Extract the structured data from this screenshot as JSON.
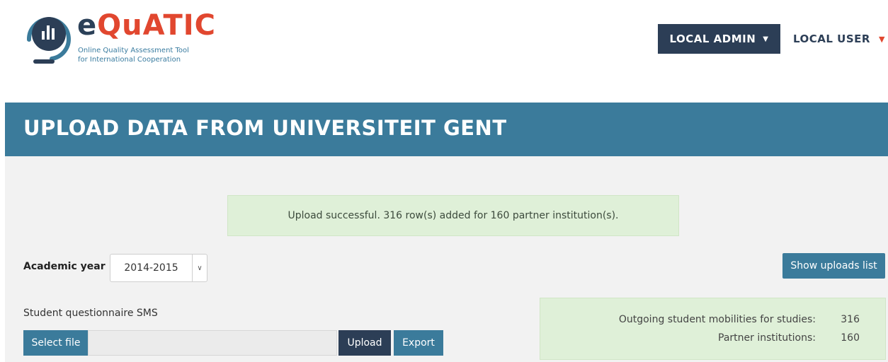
{
  "header": {
    "logo_title": "eQuATIC",
    "logo_sub_line1": "Online Quality Assessment Tool",
    "logo_sub_line2": "for International Cooperation",
    "nav_admin_label": "LOCAL ADMIN",
    "nav_user_label": "LOCAL USER"
  },
  "banner": {
    "title": "UPLOAD DATA FROM UNIVERSITEIT GENT"
  },
  "alert": {
    "message": "Upload successful. 316 row(s) added for 160 partner institution(s)."
  },
  "filters": {
    "academic_year_label": "Academic year",
    "academic_year_value": "2014-2015"
  },
  "toolbar": {
    "show_uploads_label": "Show uploads list"
  },
  "questionnaire": {
    "label": "Student questionnaire SMS",
    "select_file_label": "Select file",
    "upload_label": "Upload",
    "export_label": "Export"
  },
  "stats": {
    "rows": [
      {
        "label": "Outgoing student mobilities for studies:",
        "value": "316"
      },
      {
        "label": "Partner institutions:",
        "value": "160"
      }
    ]
  },
  "colors": {
    "primary": "#3b7b9b",
    "dark": "#2c3e56",
    "accent": "#e1472f",
    "success_bg": "#dff0d8",
    "content_bg": "#f2f2f2"
  }
}
